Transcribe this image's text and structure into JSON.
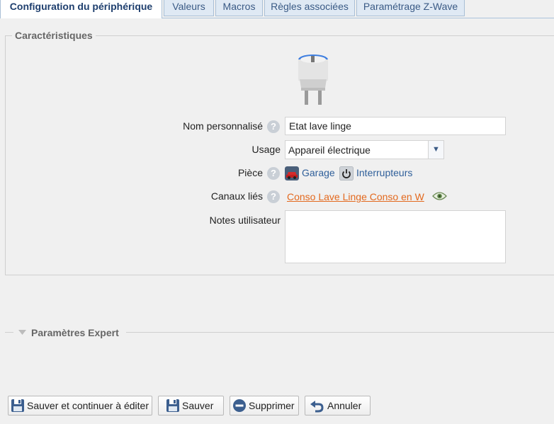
{
  "tabs": [
    {
      "label": "Configuration du périphérique",
      "active": true
    },
    {
      "label": "Valeurs"
    },
    {
      "label": "Macros"
    },
    {
      "label": "Règles associées"
    },
    {
      "label": "Paramétrage Z-Wave"
    }
  ],
  "characteristics": {
    "legend": "Caractéristiques",
    "custom_name": {
      "label": "Nom personnalisé",
      "value": "Etat lave linge"
    },
    "usage": {
      "label": "Usage",
      "value": "Appareil électrique"
    },
    "room": {
      "label": "Pièce",
      "items": [
        "Garage",
        "Interrupteurs"
      ]
    },
    "linked_channels": {
      "label": "Canaux liés",
      "value": "Conso Lave Linge Conso en W"
    },
    "notes": {
      "label": "Notes utilisateur",
      "value": ""
    }
  },
  "expert": {
    "legend": "Paramètres Expert"
  },
  "buttons": {
    "save_continue": "Sauver et continuer à éditer",
    "save": "Sauver",
    "delete": "Supprimer",
    "cancel": "Annuler"
  },
  "colors": {
    "link": "#2f5f9a",
    "linked_channel": "#e3691e",
    "tab_active_text": "#1f3f6e"
  }
}
